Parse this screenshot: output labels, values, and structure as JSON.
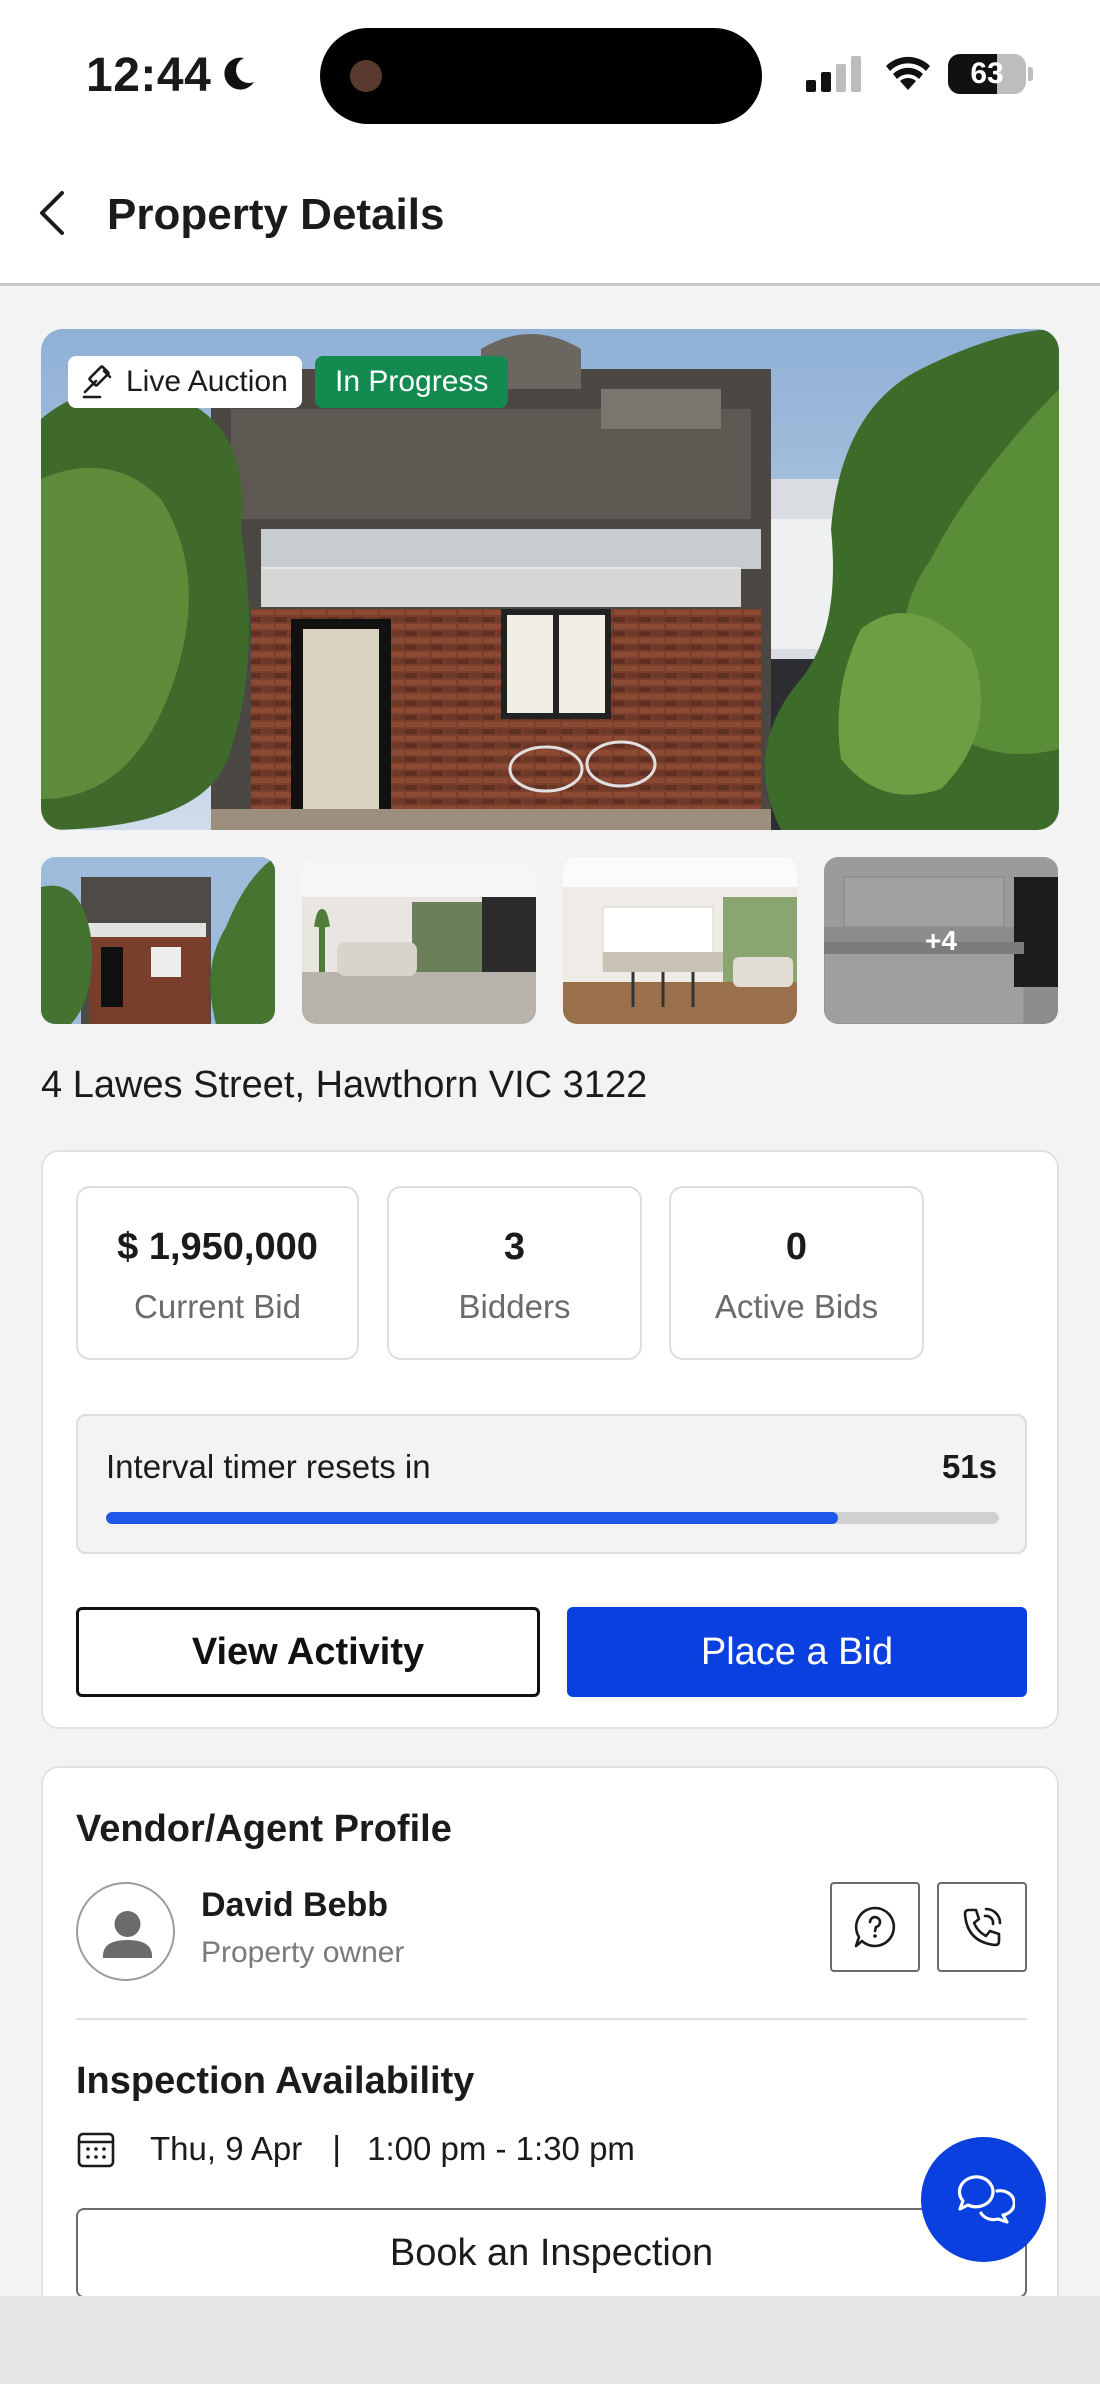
{
  "status_bar": {
    "time": "12:44",
    "battery": "63",
    "battery_level": 0.63
  },
  "header": {
    "title": "Property Details"
  },
  "hero": {
    "badge_live": "Live Auction",
    "badge_status": "In Progress"
  },
  "gallery": {
    "more_count": "+4"
  },
  "property": {
    "address": "4 Lawes Street, Hawthorn VIC 3122"
  },
  "auction": {
    "stats": [
      {
        "value": "$ 1,950,000",
        "label": "Current Bid"
      },
      {
        "value": "3",
        "label": "Bidders"
      },
      {
        "value": "0",
        "label": "Active Bids"
      }
    ],
    "timer_label": "Interval timer resets in",
    "timer_value": "51s",
    "timer_progress": 0.82,
    "view_activity_label": "View Activity",
    "place_bid_label": "Place a Bid"
  },
  "vendor": {
    "section_title": "Vendor/Agent Profile",
    "name": "David Bebb",
    "role": "Property owner"
  },
  "inspection": {
    "title": "Inspection Availability",
    "date": "Thu, 9 Apr",
    "separator": "|",
    "time": "1:00 pm - 1:30 pm",
    "book_label": "Book an Inspection"
  },
  "colors": {
    "primary": "#0a40e0",
    "status_green": "#138a4f",
    "timer_bar": "#1f57e8"
  }
}
